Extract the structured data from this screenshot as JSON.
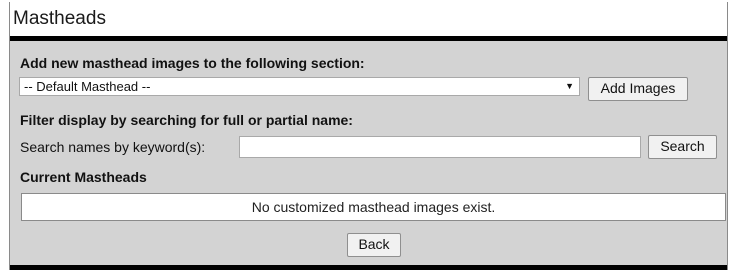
{
  "page": {
    "title": "Mastheads"
  },
  "add_section": {
    "heading": "Add new masthead images to the following section:",
    "select_value": "-- Default Masthead --",
    "add_button_label": "Add Images"
  },
  "filter_section": {
    "heading": "Filter display by searching for full or partial name:",
    "search_label": "Search names by keyword(s):",
    "search_value": "",
    "search_button_label": "Search"
  },
  "current_section": {
    "heading": "Current Mastheads",
    "empty_message": "No customized masthead images exist."
  },
  "footer": {
    "back_button_label": "Back"
  },
  "colors": {
    "panel_bg": "#d3d3d3",
    "bar": "#000000",
    "button_bg": "#f1f1f1"
  }
}
